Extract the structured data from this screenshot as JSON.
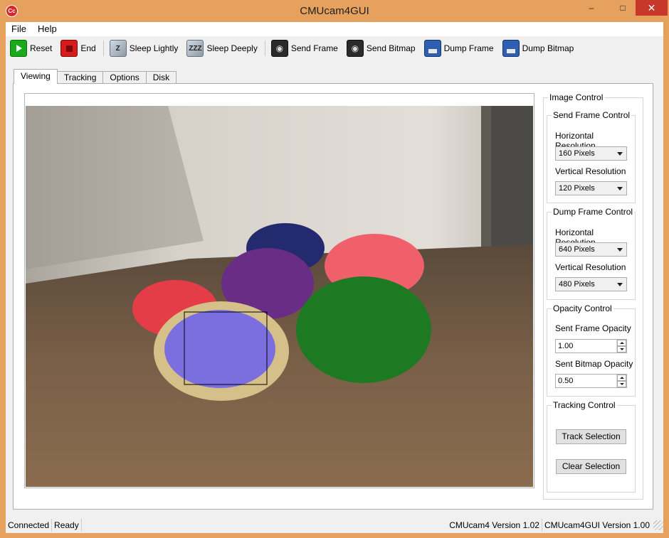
{
  "window": {
    "title": "CMUcam4GUI",
    "icon_text": "Cc",
    "minimize": "–",
    "maximize": "□",
    "close": "✕"
  },
  "menu": {
    "file": "File",
    "help": "Help"
  },
  "toolbar": {
    "reset": "Reset",
    "end": "End",
    "sleep_lightly": "Sleep Lightly",
    "sleep_deeply": "Sleep Deeply",
    "send_frame": "Send Frame",
    "send_bitmap": "Send Bitmap",
    "dump_frame": "Dump Frame",
    "dump_bitmap": "Dump Bitmap",
    "sleep_lightly_glyph": "Z",
    "sleep_deeply_glyph": "ZZZ",
    "camera_glyph": "◉"
  },
  "tabs": [
    "Viewing",
    "Tracking",
    "Options",
    "Disk"
  ],
  "active_tab": "Viewing",
  "image_control": {
    "title": "Image Control",
    "send_frame_control": {
      "title": "Send Frame Control",
      "horizontal_label": "Horizontal Resolution",
      "horizontal_value": "160 Pixels",
      "vertical_label": "Vertical Resolution",
      "vertical_value": "120 Pixels"
    },
    "dump_frame_control": {
      "title": "Dump Frame Control",
      "horizontal_label": "Horizontal Resolution",
      "horizontal_value": "640 Pixels",
      "vertical_label": "Vertical Resolution",
      "vertical_value": "480 Pixels"
    },
    "opacity_control": {
      "title": "Opacity Control",
      "sent_frame_label": "Sent Frame Opacity",
      "sent_frame_value": "1.00",
      "sent_bitmap_label": "Sent Bitmap Opacity",
      "sent_bitmap_value": "0.50"
    },
    "tracking_control": {
      "title": "Tracking Control",
      "track_selection": "Track Selection",
      "clear_selection": "Clear Selection"
    }
  },
  "status": {
    "connection": "Connected",
    "state": "Ready",
    "cmucam_version": "CMUcam4 Version 1.02",
    "gui_version": "CMUcam4GUI Version 1.00"
  },
  "colors": {
    "frame_accent": "#e6a15e",
    "close_button": "#c7382b",
    "tracked_overlay": "#7b6fe0"
  }
}
